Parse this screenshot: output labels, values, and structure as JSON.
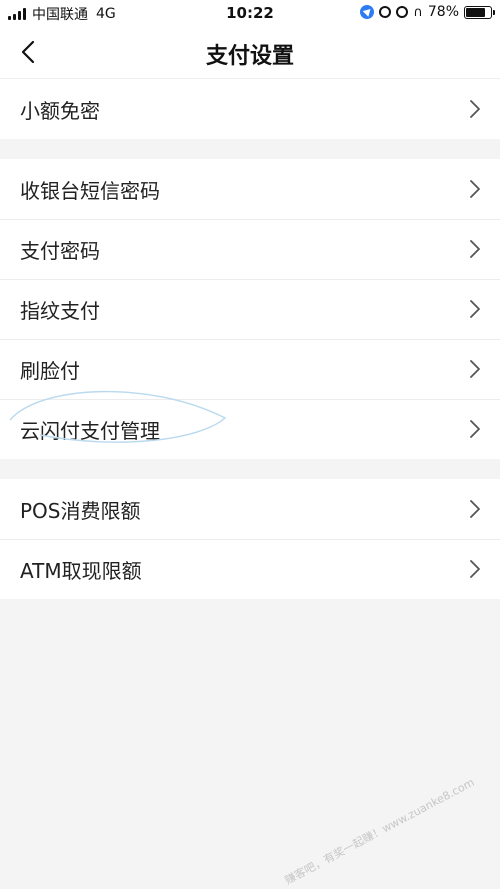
{
  "status": {
    "carrier": "中国联通",
    "network": "4G",
    "time": "10:22",
    "battery_text": "78%",
    "battery_level": 0.78
  },
  "nav": {
    "title": "支付设置",
    "back_icon": "chevron-left-icon"
  },
  "groups": [
    {
      "items": [
        {
          "label": "小额免密"
        }
      ]
    },
    {
      "items": [
        {
          "label": "收银台短信密码"
        },
        {
          "label": "支付密码"
        },
        {
          "label": "指纹支付"
        },
        {
          "label": "刷脸付"
        },
        {
          "label": "云闪付支付管理"
        }
      ]
    },
    {
      "items": [
        {
          "label": "POS消费限额"
        },
        {
          "label": "ATM取现限额"
        }
      ]
    }
  ],
  "watermark": "赚客吧，有奖一起赚！www.zuanke8.com",
  "colors": {
    "background": "#f4f4f4",
    "accent": "#2f7bf5"
  }
}
